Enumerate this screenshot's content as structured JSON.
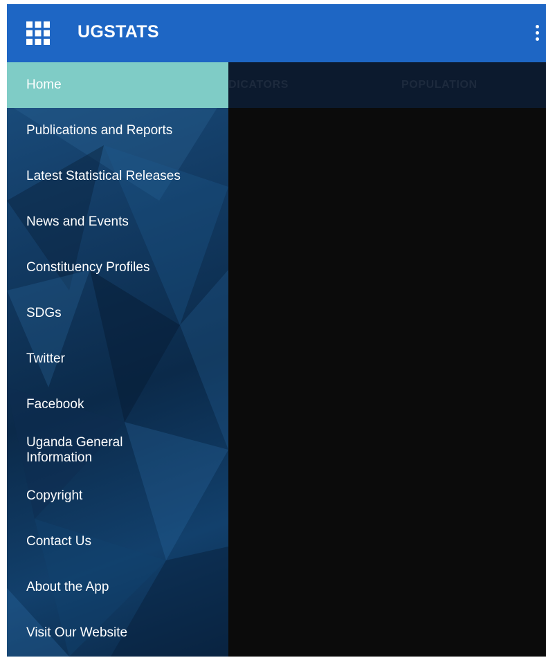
{
  "app_bar": {
    "title": "UGSTATS",
    "menu_icon": "apps-grid-icon",
    "overflow_icon": "more-vert-icon",
    "color": "#1e66c4"
  },
  "tabs": [
    {
      "label": "GULAR INDICATORS"
    },
    {
      "label": "POPULATION"
    }
  ],
  "drawer": {
    "active_color": "#7fccc6",
    "items": [
      {
        "label": "Home",
        "active": true
      },
      {
        "label": "Publications and Reports"
      },
      {
        "label": "Latest Statistical Releases"
      },
      {
        "label": "News and Events"
      },
      {
        "label": "Constituency Profiles"
      },
      {
        "label": "SDGs"
      },
      {
        "label": "Twitter"
      },
      {
        "label": "Facebook"
      },
      {
        "label": "Uganda General Information"
      },
      {
        "label": "Copyright"
      },
      {
        "label": "Contact Us"
      },
      {
        "label": "About the App"
      },
      {
        "label": "Visit Our Website"
      }
    ]
  }
}
